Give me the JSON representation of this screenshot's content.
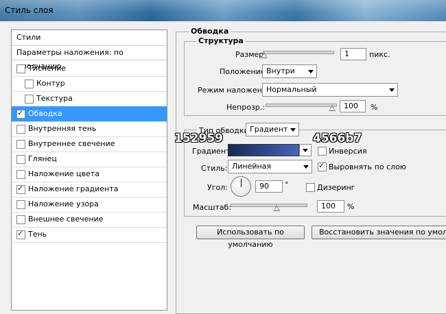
{
  "window": {
    "title": "Стиль слоя"
  },
  "left_panel": {
    "header": "Стили",
    "blend_options": "Параметры наложения: по умолчанию",
    "items": [
      {
        "label": "Тиснение",
        "checked": false
      },
      {
        "label": "Контур",
        "checked": false
      },
      {
        "label": "Текстура",
        "checked": false
      },
      {
        "label": "Обводка",
        "checked": true
      },
      {
        "label": "Внутренняя тень",
        "checked": false
      },
      {
        "label": "Внутреннее свечение",
        "checked": false
      },
      {
        "label": "Глянец",
        "checked": false
      },
      {
        "label": "Наложение цвета",
        "checked": false
      },
      {
        "label": "Наложение градиента",
        "checked": true
      },
      {
        "label": "Наложение узора",
        "checked": false
      },
      {
        "label": "Внешнее свечение",
        "checked": false
      },
      {
        "label": "Тень",
        "checked": true
      }
    ]
  },
  "stroke": {
    "section_title": "Обводка",
    "structure_title": "Структура",
    "size_label": "Размер:",
    "size_value": "1",
    "size_unit": "пикс.",
    "position_label": "Положение:",
    "position_value": "Внутри",
    "blend_mode_label": "Режим наложения:",
    "blend_mode_value": "Нормальный",
    "opacity_label": "Непрозр.:",
    "opacity_value": "100",
    "opacity_unit": "%",
    "fill_type_label": "Тип обводки:",
    "fill_type_value": "Градиент",
    "gradient_label": "Градиент:",
    "gradient_colors": [
      "#152959",
      "#4566b7"
    ],
    "reverse_label": "Инверсия",
    "reverse_checked": false,
    "style_label": "Стиль:",
    "style_value": "Линейная",
    "align_label": "Выровнять по слою",
    "align_checked": true,
    "angle_label": "Угол:",
    "angle_value": "90",
    "angle_unit": "°",
    "dither_label": "Дизеринг",
    "dither_checked": false,
    "scale_label": "Масштаб:",
    "scale_value": "100",
    "scale_unit": "%"
  },
  "buttons": {
    "default": "Использовать по умолчанию",
    "reset": "Восстановить значения по умолчанию"
  },
  "annotations": {
    "left_hex": "152959",
    "right_hex": "4566b7"
  }
}
